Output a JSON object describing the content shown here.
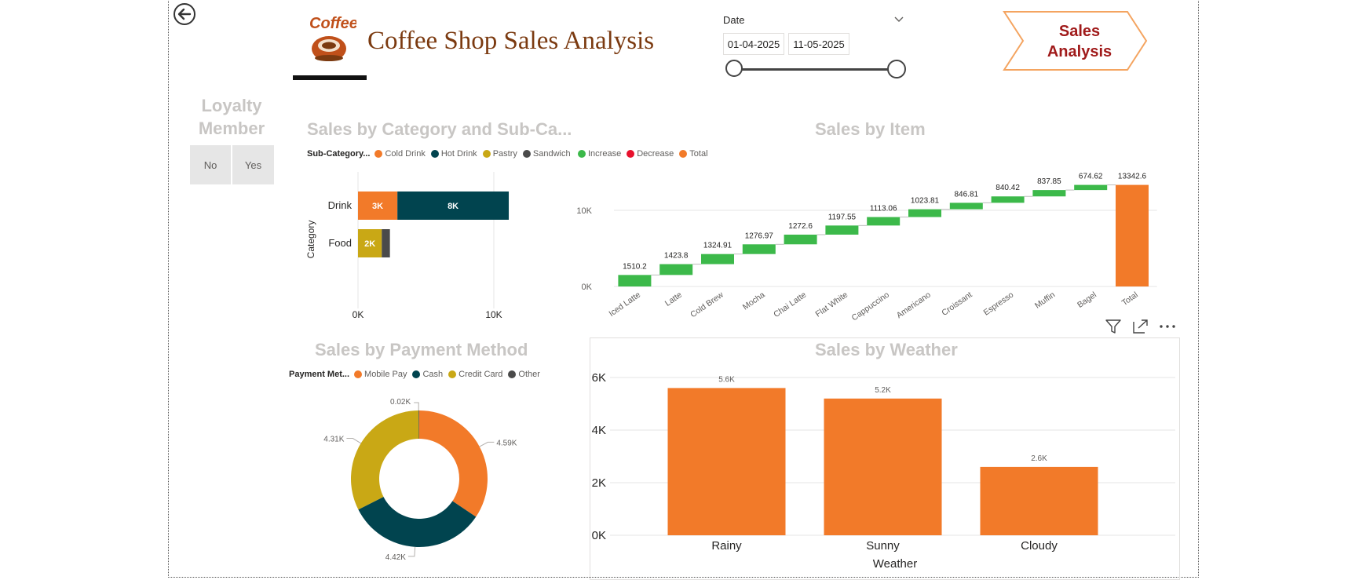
{
  "header": {
    "title": "Coffee Shop Sales Analysis",
    "logo_text": "Coffee",
    "nav_button_label": "Sales Analysis",
    "back_icon": "back-arrow-icon"
  },
  "date_slicer": {
    "label": "Date",
    "start": "01-04-2025",
    "end": "11-05-2025"
  },
  "loyalty_slicer": {
    "title": "Loyalty Member",
    "options": [
      "No",
      "Yes"
    ]
  },
  "visual_toolbar": {
    "icons": [
      "filter-icon",
      "focus-mode-icon",
      "more-options-icon"
    ]
  },
  "colors": {
    "orange": "#f27a29",
    "teal": "#01444f",
    "gold": "#c9a815",
    "gray": "#4a4a4a",
    "green": "#3cb94a",
    "red": "#e8112d",
    "title_brown": "#7b3a10",
    "nav_red": "#a01a1a"
  },
  "chart_data": [
    {
      "id": "category",
      "type": "bar",
      "orientation": "horizontal",
      "stacked": true,
      "title": "Sales by Category and Sub-Ca...",
      "legend_title": "Sub-Category...",
      "ylabel": "Category",
      "categories": [
        "Drink",
        "Food"
      ],
      "series": [
        {
          "name": "Cold Drink",
          "values": [
            2900,
            0
          ],
          "labels": [
            "3K",
            ""
          ]
        },
        {
          "name": "Hot Drink",
          "values": [
            8200,
            0
          ],
          "labels": [
            "8K",
            ""
          ]
        },
        {
          "name": "Pastry",
          "values": [
            0,
            1750
          ],
          "labels": [
            "",
            "2K"
          ]
        },
        {
          "name": "Sandwich",
          "values": [
            0,
            600
          ],
          "labels": [
            "",
            ""
          ]
        }
      ],
      "xticks": [
        "0K",
        "10K"
      ],
      "xlim": [
        0,
        10000
      ],
      "grid": true
    },
    {
      "id": "item",
      "type": "waterfall",
      "title": "Sales by Item",
      "legend": [
        "Increase",
        "Decrease",
        "Total"
      ],
      "categories": [
        "Iced Latte",
        "Latte",
        "Cold Brew",
        "Mocha",
        "Chai Latte",
        "Flat White",
        "Cappuccino",
        "Americano",
        "Croissant",
        "Espresso",
        "Muffin",
        "Bagel",
        "Total"
      ],
      "values": [
        1510.2,
        1423.8,
        1324.91,
        1276.97,
        1272.6,
        1197.55,
        1113.06,
        1023.81,
        846.81,
        840.42,
        837.85,
        674.62,
        13342.6
      ],
      "labels": [
        "1510.2",
        "1423.8",
        "1324.91",
        "1276.97",
        "1272.6",
        "1197.55",
        "1113.06",
        "1023.81",
        "846.81",
        "840.42",
        "837.85",
        "674.62",
        "13342.6"
      ],
      "yticks": [
        "0K",
        "10K"
      ],
      "ylim": [
        0,
        10000
      ],
      "grid": true
    },
    {
      "id": "payment",
      "type": "pie",
      "donut": true,
      "title": "Sales by Payment Method",
      "legend_title": "Payment Met...",
      "labels": [
        "Mobile Pay",
        "Cash",
        "Credit Card",
        "Other"
      ],
      "values": [
        4590,
        4420,
        4310,
        20
      ],
      "value_labels": [
        "4.59K",
        "4.42K",
        "4.31K",
        "0.02K"
      ]
    },
    {
      "id": "weather",
      "type": "bar",
      "title": "Sales by Weather",
      "xlabel": "Weather",
      "categories": [
        "Rainy",
        "Sunny",
        "Cloudy"
      ],
      "values": [
        5600,
        5200,
        2600
      ],
      "labels": [
        "5.6K",
        "5.2K",
        "2.6K"
      ],
      "yticks": [
        "0K",
        "2K",
        "4K",
        "6K"
      ],
      "ylim": [
        0,
        6000
      ],
      "grid": true
    }
  ]
}
